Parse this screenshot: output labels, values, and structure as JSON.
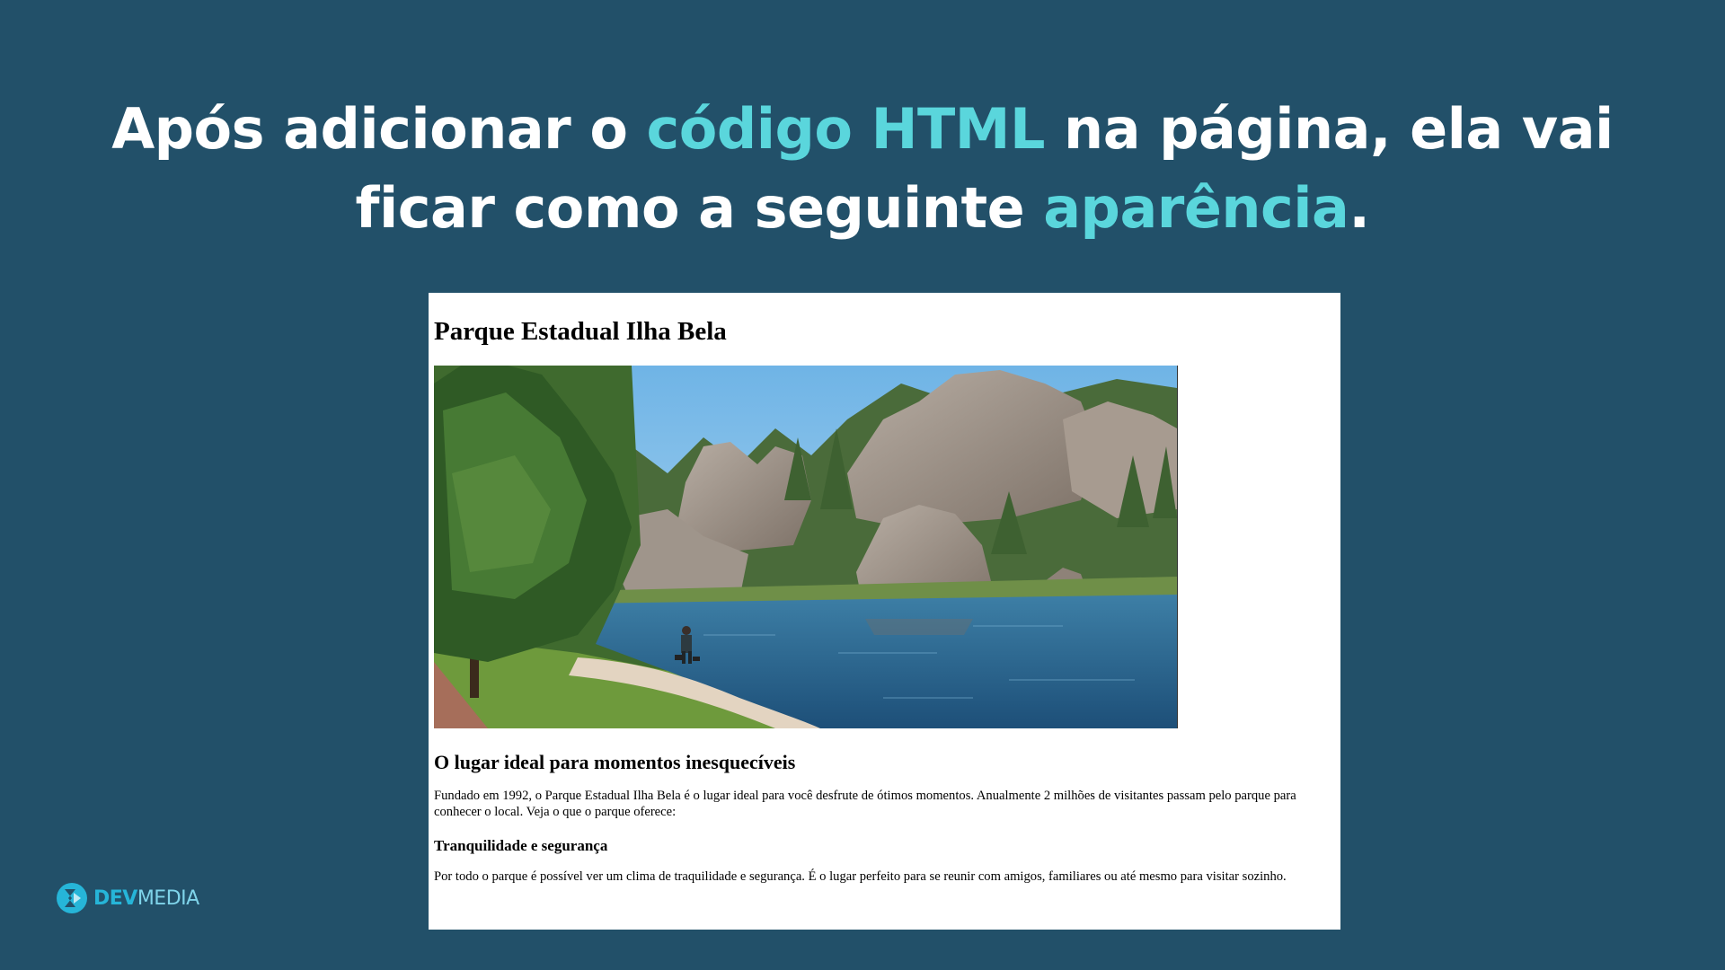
{
  "headline": {
    "line1_a": "Após adicionar o ",
    "line1_accent": "código HTML",
    "line1_b": " na página, ela vai",
    "line2_a": "ficar como a seguinte ",
    "line2_accent": "aparência",
    "line2_b": "."
  },
  "preview": {
    "title": "Parque Estadual Ilha Bela",
    "subtitle": "O lugar ideal para momentos inesquecíveis",
    "paragraph1": "Fundado em 1992, o Parque Estadual Ilha Bela é o lugar ideal para você desfrute de ótimos momentos. Anualmente 2 milhões de visitantes passam pelo parque para conhecer o local. Veja o que o parque oferece:",
    "section_title": "Tranquilidade e segurança",
    "paragraph2": "Por todo o parque é possível ver um clima de traquilidade e segurança. É o lugar perfeito para se reunir com amigos, familiares ou até mesmo para visitar sozinho."
  },
  "logo": {
    "bold": "DEV",
    "light": "MEDIA"
  },
  "colors": {
    "background": "#225069",
    "accent": "#5ad6dc",
    "panel": "#ffffff",
    "brand": "#26b5d8"
  }
}
